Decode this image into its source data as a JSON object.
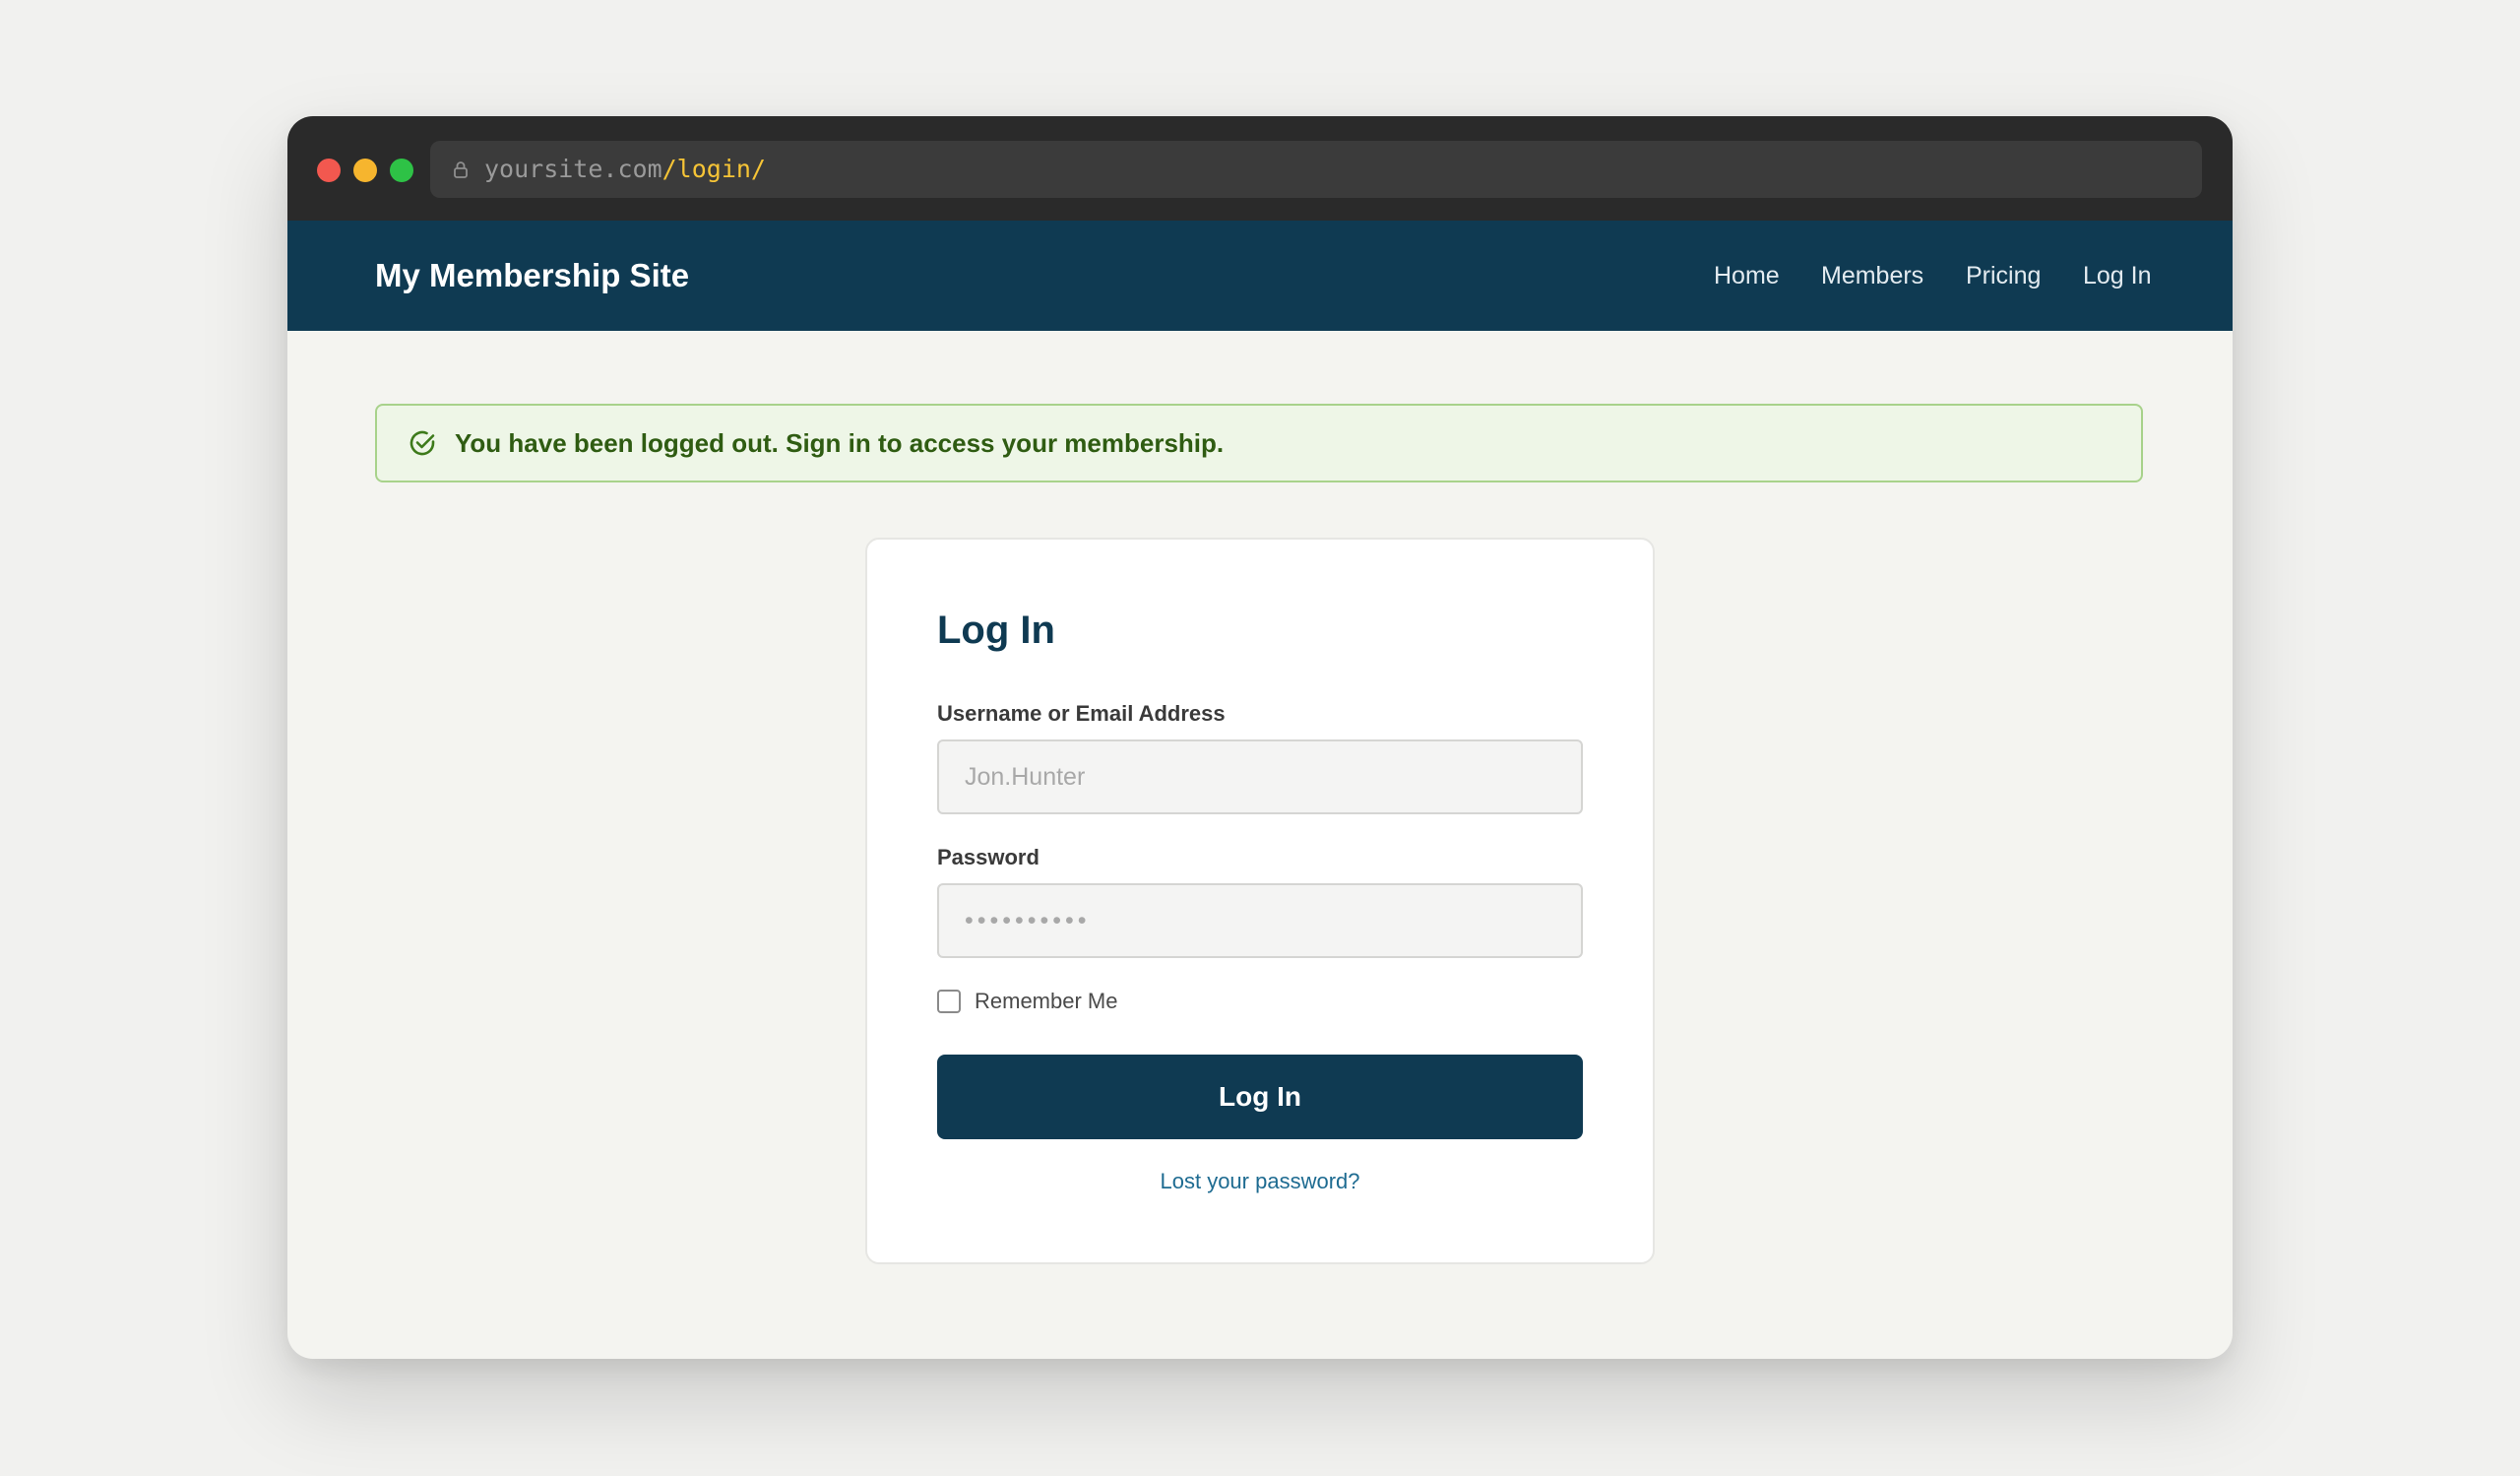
{
  "browser": {
    "url_domain": "yoursite.com",
    "url_path": "/login/",
    "traffic_light_colors": [
      "#f2584f",
      "#f6b52e",
      "#2ec246"
    ]
  },
  "header": {
    "site_title": "My Membership Site",
    "nav": {
      "home": "Home",
      "members": "Members",
      "pricing": "Pricing",
      "login": "Log In"
    },
    "background_color": "#0f3a52"
  },
  "notice": {
    "icon": "check-circle-icon",
    "text": "You have been logged out. Sign in to access your membership.",
    "color": "#2f5c12"
  },
  "login_form": {
    "title": "Log In",
    "username_label": "Username or Email Address",
    "username_placeholder": "Jon.Hunter",
    "password_label": "Password",
    "password_placeholder": "••••••••••",
    "remember_label": "Remember Me",
    "remember_checked": false,
    "submit_label": "Log In",
    "lost_password_label": "Lost your password?"
  }
}
